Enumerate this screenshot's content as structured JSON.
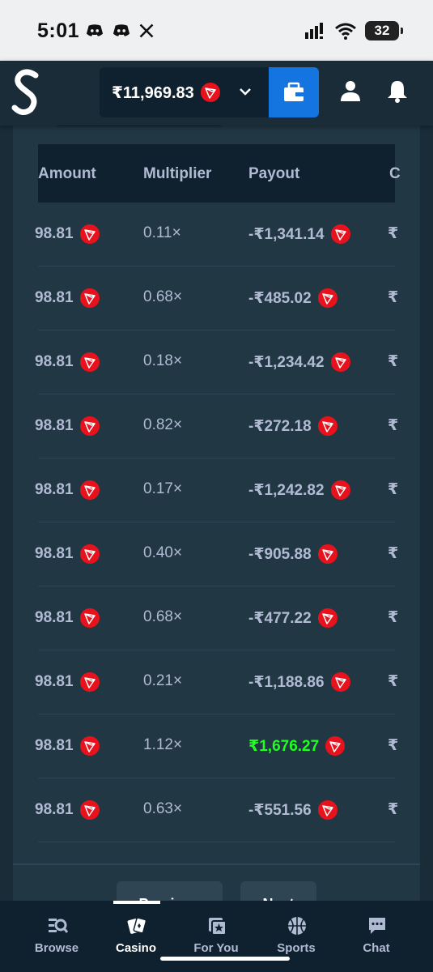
{
  "status_bar": {
    "time": "5:01",
    "battery": "32"
  },
  "header": {
    "balance": "₹11,969.83"
  },
  "table": {
    "columns": [
      "Amount",
      "Multiplier",
      "Payout",
      "C"
    ],
    "rows": [
      {
        "amount": "98.81",
        "multiplier": "0.11×",
        "payout": "-₹1,341.14",
        "cut": "₹"
      },
      {
        "amount": "98.81",
        "multiplier": "0.68×",
        "payout": "-₹485.02",
        "cut": "₹"
      },
      {
        "amount": "98.81",
        "multiplier": "0.18×",
        "payout": "-₹1,234.42",
        "cut": "₹"
      },
      {
        "amount": "98.81",
        "multiplier": "0.82×",
        "payout": "-₹272.18",
        "cut": "₹"
      },
      {
        "amount": "98.81",
        "multiplier": "0.17×",
        "payout": "-₹1,242.82",
        "cut": "₹"
      },
      {
        "amount": "98.81",
        "multiplier": "0.40×",
        "payout": "-₹905.88",
        "cut": "₹"
      },
      {
        "amount": "98.81",
        "multiplier": "0.68×",
        "payout": "-₹477.22",
        "cut": "₹"
      },
      {
        "amount": "98.81",
        "multiplier": "0.21×",
        "payout": "-₹1,188.86",
        "cut": "₹"
      },
      {
        "amount": "98.81",
        "multiplier": "1.12×",
        "payout": "₹1,676.27",
        "cut": "₹"
      },
      {
        "amount": "98.81",
        "multiplier": "0.63×",
        "payout": "-₹551.56",
        "cut": "₹"
      }
    ]
  },
  "pagination": {
    "previous_label": "Previous",
    "next_label": "Next"
  },
  "nav": {
    "items": [
      {
        "label": "Browse"
      },
      {
        "label": "Casino"
      },
      {
        "label": "For You"
      },
      {
        "label": "Sports"
      },
      {
        "label": "Chat"
      }
    ]
  },
  "colors": {
    "win": "#1fff20",
    "accent": "#1475e1",
    "coin": "#e8121d"
  }
}
